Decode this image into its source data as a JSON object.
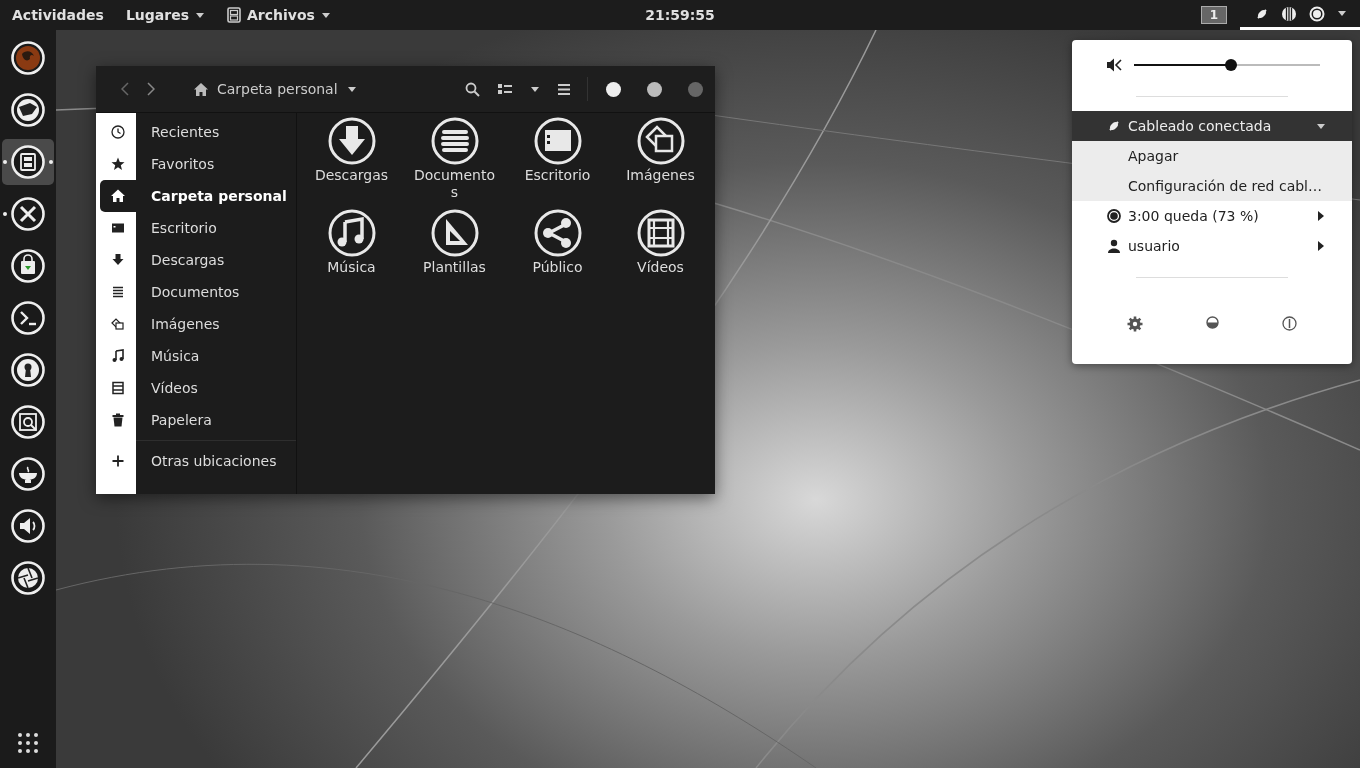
{
  "top_bar": {
    "activities": "Actividades",
    "places": {
      "label": "Lugares"
    },
    "app_menu": {
      "label": "Archivos"
    },
    "clock": "21:59:55",
    "workspace": "1",
    "status_menu_open": true
  },
  "dock": {
    "apps": [
      {
        "running": false,
        "selected": false
      },
      {
        "running": false,
        "selected": false
      },
      {
        "running": true,
        "selected": true
      },
      {
        "running": true,
        "selected": false
      },
      {
        "running": false,
        "selected": false
      },
      {
        "running": false,
        "selected": false
      },
      {
        "running": false,
        "selected": false
      },
      {
        "running": false,
        "selected": false
      },
      {
        "running": false,
        "selected": false
      },
      {
        "running": false,
        "selected": false
      },
      {
        "running": false,
        "selected": false
      }
    ]
  },
  "file_window": {
    "location": "Carpeta personal",
    "sidebar": {
      "items": [
        {
          "label": "Recientes",
          "selected": false
        },
        {
          "label": "Favoritos",
          "selected": false
        },
        {
          "label": "Carpeta personal",
          "selected": true
        },
        {
          "label": "Escritorio",
          "selected": false
        },
        {
          "label": "Descargas",
          "selected": false
        },
        {
          "label": "Documentos",
          "selected": false
        },
        {
          "label": "Imágenes",
          "selected": false
        },
        {
          "label": "Música",
          "selected": false
        },
        {
          "label": "Vídeos",
          "selected": false
        },
        {
          "label": "Papelera",
          "selected": false
        }
      ],
      "other_locations": "Otras ubicaciones"
    },
    "folders": [
      "Descargas",
      "Documentos",
      "Escritorio",
      "Imágenes",
      "Música",
      "Plantillas",
      "Público",
      "Vídeos"
    ]
  },
  "status_menu": {
    "volume": {
      "level": 0.52
    },
    "network": {
      "label": "Cableado conectada",
      "expanded": true,
      "items": [
        "Apagar",
        "Configuración de red cabl…"
      ]
    },
    "battery": "3:00 queda (73 %)",
    "user": "usuario"
  }
}
